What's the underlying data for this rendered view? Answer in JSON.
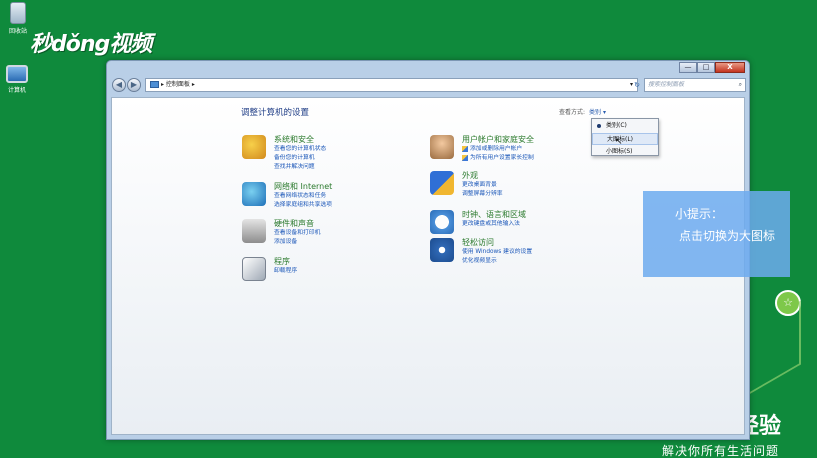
{
  "desktop": {
    "icons": [
      {
        "label": "回收站"
      },
      {
        "label": "计算机"
      }
    ],
    "logo": "秒dǒng视频",
    "watermark": "经验",
    "slogan": "解决你所有生活问题"
  },
  "window": {
    "address": "▸ 控制面板 ▸",
    "search_placeholder": "搜索控制面板",
    "buttons": {
      "minimize": "—",
      "maximize": "□",
      "close": "X"
    }
  },
  "controlpanel": {
    "title": "调整计算机的设置",
    "view_by_label": "查看方式:",
    "view_by_value": "类别 ▾",
    "view_menu": [
      "类别(C)",
      "大图标(L)",
      "小图标(S)"
    ],
    "categories": [
      {
        "title": "系统和安全",
        "links": [
          "查看您的计算机状态",
          "备份您的计算机",
          "查找并解决问题"
        ]
      },
      {
        "title": "网络和 Internet",
        "links": [
          "查看网络状态和任务",
          "选择家庭组和共享选项"
        ]
      },
      {
        "title": "硬件和声音",
        "links": [
          "查看设备和打印机",
          "添加设备"
        ]
      },
      {
        "title": "程序",
        "links": [
          "卸载程序"
        ]
      },
      {
        "title": "用户帐户和家庭安全",
        "links": [
          "添加或删除用户帐户",
          "为所有用户设置家长控制"
        ]
      },
      {
        "title": "外观",
        "links": [
          "更改桌面背景",
          "调整屏幕分辨率"
        ]
      },
      {
        "title": "时钟、语言和区域",
        "links": [
          "更改键盘或其他输入法"
        ]
      },
      {
        "title": "轻松访问",
        "links": [
          "使用 Windows 建议的设置",
          "优化视频显示"
        ]
      }
    ]
  },
  "tip": {
    "title": "小提示：",
    "text": "点击切换为大图标"
  }
}
